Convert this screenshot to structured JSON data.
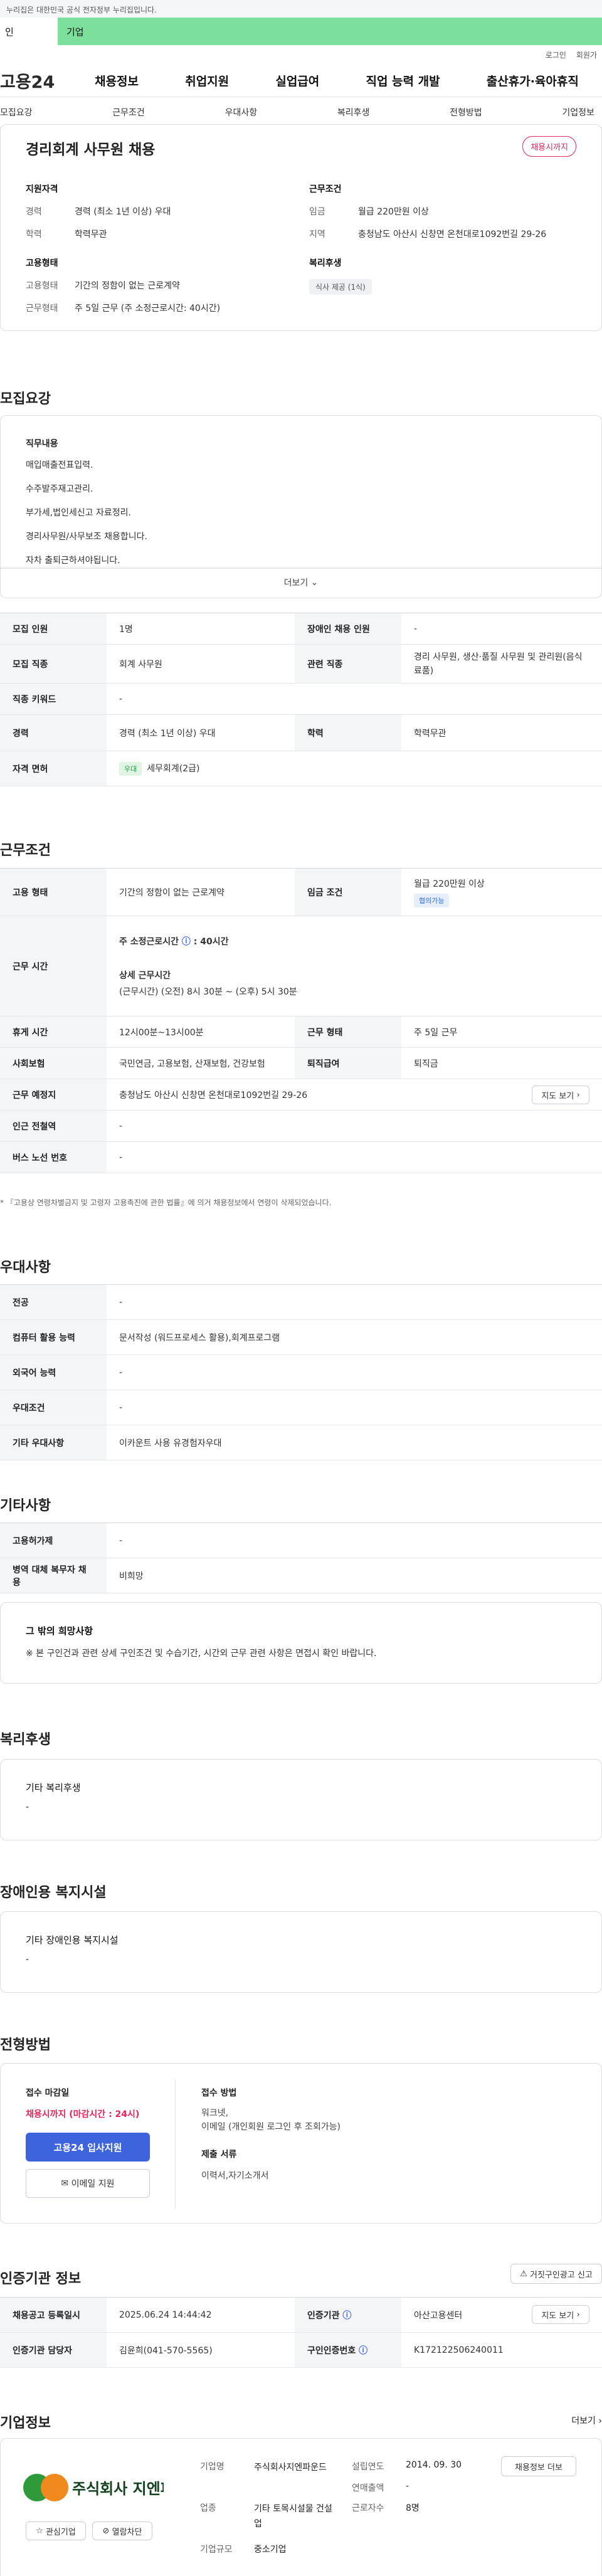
{
  "gov_banner": "이 누리집은 대한민국 공식 전자정부 누리집입니다.",
  "gov_banner_shown": "누리집은 대한민국 공식 전자정부 누리집입니다.",
  "green_bar": {
    "personal": "인",
    "corporate": "기업"
  },
  "util": {
    "login": "로그인",
    "join": "회원가"
  },
  "logo": "고용24",
  "gnb": [
    "채용정보",
    "취업지원",
    "실업급여",
    "직업 능력 개발",
    "출산휴가·육아휴직"
  ],
  "tabs": [
    "모집요강",
    "근무조건",
    "우대사항",
    "복리후생",
    "전형방법",
    "기업정보"
  ],
  "header": {
    "title": "경리회계 사무원 채용",
    "status": "채용시까지",
    "qual_h": "지원자격",
    "career_k": "경력",
    "career_v": "경력 (최소 1년 이상) 우대",
    "edu_k": "학력",
    "edu_v": "학력무관",
    "cond_h": "근무조건",
    "wage_k": "임금",
    "wage_v": "월급 220만원 이상",
    "area_k": "지역",
    "area_v": "충청남도 아산시 신창면 온천대로1092번길 29-26",
    "emp_h": "고용형태",
    "emptype_k": "고용형태",
    "emptype_v": "기간의 정함이 없는 근로계약",
    "worktype_k": "근무형태",
    "worktype_v": "주 5일 근무 (주 소정근로시간: 40시간)",
    "welfare_h": "복리후생",
    "welfare_chip": "식사 제공 (1식)"
  },
  "recruit": {
    "title": "모집요강",
    "duty_h": "직무내용",
    "duties": [
      "매입매출전표입력.",
      "수주발주재고관리.",
      "부가세,법인세신고 자료정리.",
      "경리사무원/사무보조 채용합니다.",
      "자차 출퇴근하셔야됩니다."
    ],
    "more": "더보기",
    "table": {
      "r1": [
        "모집 인원",
        "1명",
        "장애인 채용 인원",
        "-"
      ],
      "r2": [
        "모집 직종",
        "회계 사무원",
        "관련 직종",
        "경리 사무원, 생산·품질 사무원 및 관리원(음식료품)"
      ],
      "r3": [
        "직종 키워드",
        "-"
      ],
      "r4": [
        "경력",
        "경력 (최소 1년 이상) 우대",
        "학력",
        "학력무관"
      ],
      "r5": [
        "자격 면허",
        "우대",
        "세무회계(2급)"
      ]
    }
  },
  "work": {
    "title": "근무조건",
    "emp": [
      "고용 형태",
      "기간의 정함이 없는 근로계약",
      "임금 조건",
      "월급 220만원 이상",
      "협의가능"
    ],
    "hours": [
      "근무 시간",
      "주 소정근로시간",
      "40시간",
      "상세 근무시간",
      "(근무시간) (오전) 8시 30분 ~ (오후) 5시 30분"
    ],
    "rest": [
      "휴게 시간",
      "12시00분~13시00분",
      "근무 형태",
      "주 5일 근무"
    ],
    "ins": [
      "사회보험",
      "국민연금, 고용보험, 산재보험, 건강보험",
      "퇴직급여",
      "퇴직금"
    ],
    "place": [
      "근무 예정지",
      "충청남도 아산시 신창면 온천대로1092번길 29-26",
      "지도 보기"
    ],
    "subway": [
      "인근 전철역",
      "-"
    ],
    "bus": [
      "버스 노선 번호",
      "-"
    ],
    "note": "* 『고용상 연령차별금지 및 고령자 고용촉진에 관한 법률』에 의거 채용정보에서 연령이 삭제되었습니다."
  },
  "pref": {
    "title": "우대사항",
    "rows": [
      [
        "전공",
        "-"
      ],
      [
        "컴퓨터 활용 능력",
        "문서작성 (워드프로세스 활용),회계프로그램"
      ],
      [
        "외국어 능력",
        "-"
      ],
      [
        "우대조건",
        "-"
      ],
      [
        "기타 우대사항",
        "이카운트 사용 유경험자우대"
      ]
    ]
  },
  "etc": {
    "title": "기타사항",
    "rows": [
      [
        "고용허가제",
        "-"
      ],
      [
        "병역 대체 복무자 채용",
        "비희망"
      ]
    ],
    "box_h": "그 밖의 희망사항",
    "box_v": "※ 본 구인건과 관련 상세 구인조건 및 수습기간, 시간외 근무 관련 사항은 면접시 확인 바랍니다."
  },
  "benefit": {
    "title": "복리후생",
    "box_h": "기타 복리후생",
    "box_v": "-"
  },
  "disab": {
    "title": "장애인용 복지시설",
    "box_h": "기타 장애인용 복지시설",
    "box_v": "-"
  },
  "screen": {
    "title": "전형방법",
    "deadline_h": "접수 마감일",
    "deadline_v": "채용시까지 (마감시간 : 24시)",
    "apply_btn": "고용24 입사지원",
    "email_btn": "이메일 지원",
    "method_h": "접수 방법",
    "method_v1": "워크넷,",
    "method_v2": "이메일 (개인회원 로그인 후 조회가능)",
    "doc_h": "제출 서류",
    "doc_v": "이력서,자기소개서"
  },
  "cert": {
    "title": "인증기관 정보",
    "report": "거짓구인광고 신고",
    "r1": [
      "채용공고 등록일시",
      "2025.06.24 14:44:42",
      "인증기관",
      "아산고용센터",
      "지도 보기"
    ],
    "r2": [
      "인증기관 담당자",
      "김윤희(041-570-5565)",
      "구인인증번호",
      "K172122506240011"
    ]
  },
  "company": {
    "title": "기업정보",
    "more": "더보기",
    "logo_text": "주식회사 지엔파운드",
    "fav": "관심기업",
    "block": "열람차단",
    "k1": "기업명",
    "v1": "주식회사지엔파운드",
    "k2": "업종",
    "v2": "기타 토목시설물 건설업",
    "k3": "기업규모",
    "v3": "중소기업",
    "k4": "설립연도",
    "v4": "2014. 09. 30",
    "k5": "연매출액",
    "v5": "-",
    "k6": "근로자수",
    "v6": "8명",
    "jobs_btn": "채용정보 더보"
  },
  "colors": {
    "green": "#7cdf9b",
    "red": "#e4245a",
    "blue": "#3d63dd"
  }
}
